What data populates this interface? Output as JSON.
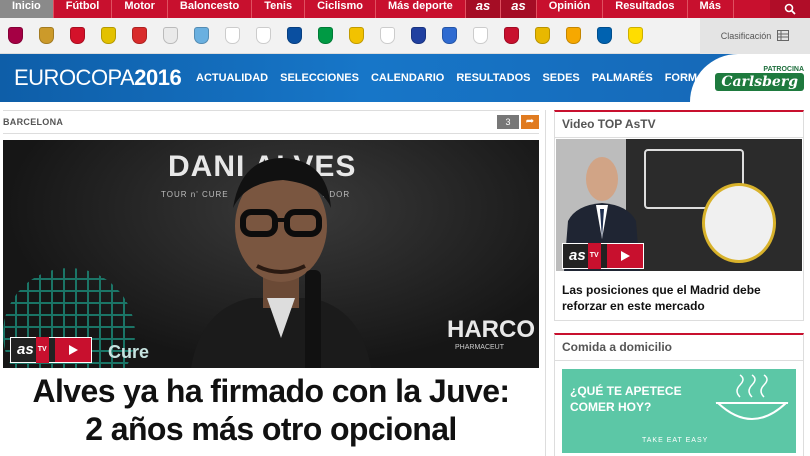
{
  "topnav": {
    "items": [
      "Inicio",
      "Fútbol",
      "Motor",
      "Baloncesto",
      "Tenis",
      "Ciclismo",
      "Más deporte"
    ],
    "logos": [
      "as",
      "as"
    ],
    "items_right": [
      "Opinión",
      "Resultados",
      "Más"
    ],
    "active_color": "#8a8a8a",
    "bg_color": "#c8102e"
  },
  "clubs": {
    "crest_colors": [
      "#a50044",
      "#cc9a2a",
      "#d4122a",
      "#e3c100",
      "#d92b2b",
      "#eaeaea",
      "#6ab0e0",
      "#ffffff",
      "#ffffff",
      "#0a4fa0",
      "#009a44",
      "#f2c200",
      "#ffffff",
      "#2040a0",
      "#2f6bd1",
      "#ffffff",
      "#c8102e",
      "#e8b800",
      "#f6a800",
      "#0062b0",
      "#ffdd00"
    ],
    "classification_label": "Clasificación"
  },
  "eurobar": {
    "logo_text": "EUROCOPA",
    "logo_year": "2016",
    "menu": [
      "ACTUALIDAD",
      "SELECCIONES",
      "CALENDARIO",
      "RESULTADOS",
      "SEDES",
      "PALMARÉS",
      "FORMATO"
    ],
    "sponsor_label": "PATROCINA",
    "sponsor_brand": "Carlsberg"
  },
  "article": {
    "section": "BARCELONA",
    "comment_count": "3",
    "image_overlay": {
      "title": "DANI ALVES",
      "subtitle_left": "TOUR n' CURE",
      "subtitle_right": "ADOR",
      "brand_left": "Cure",
      "brand_right": "HARCO",
      "brand_right_sub": "PHARMACEUT"
    },
    "video_brand": "as",
    "video_tag": "TV",
    "headline_line1": "Alves ya ha firmado con la Juve:",
    "headline_line2": "2 años más otro opcional"
  },
  "sidebar": {
    "video_widget_title": "Video TOP AsTV",
    "video_caption": "Las posiciones que el Madrid debe reforzar en este mercado",
    "food_widget_title": "Comida a domicilio",
    "food_ad_line1": "¿QUÉ TE APETECE",
    "food_ad_line2": "COMER HOY?",
    "food_ad_brand": "TAKE EAT EASY"
  }
}
